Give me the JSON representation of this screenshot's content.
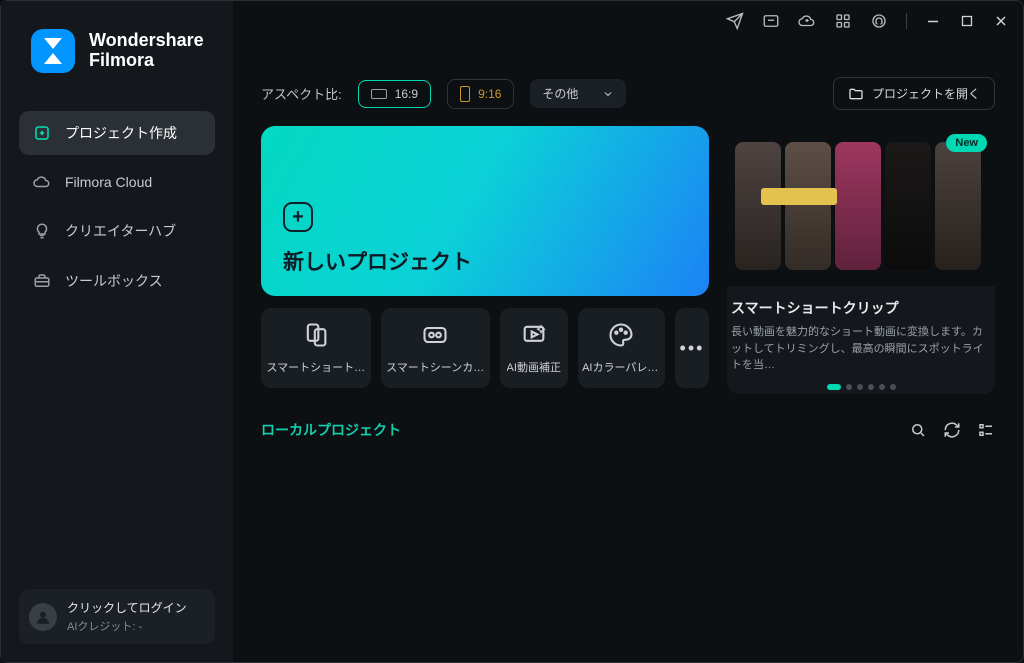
{
  "brand": {
    "line1": "Wondershare",
    "line2": "Filmora"
  },
  "sidebar": {
    "items": [
      {
        "label": "プロジェクト作成"
      },
      {
        "label": "Filmora Cloud"
      },
      {
        "label": "クリエイターハブ"
      },
      {
        "label": "ツールボックス"
      }
    ]
  },
  "login": {
    "prompt": "クリックしてログイン",
    "credits": "AIクレジット: -"
  },
  "top": {
    "aspect_label": "アスペクト比:",
    "ratio_16_9": "16:9",
    "ratio_9_16": "9:16",
    "other": "その他",
    "open_project": "プロジェクトを開く"
  },
  "newproject": {
    "label": "新しいプロジェクト"
  },
  "tools": [
    {
      "label": "スマートショートク…"
    },
    {
      "label": "スマートシーンカット"
    },
    {
      "label": "AI動画補正"
    },
    {
      "label": "AIカラーパレット"
    }
  ],
  "feature": {
    "badge": "New",
    "title": "スマートショートクリップ",
    "desc": "長い動画を魅力的なショート動画に変換します。カットしてトリミングし、最高の瞬間にスポットライトを当…"
  },
  "section": {
    "local_projects": "ローカルプロジェクト"
  }
}
